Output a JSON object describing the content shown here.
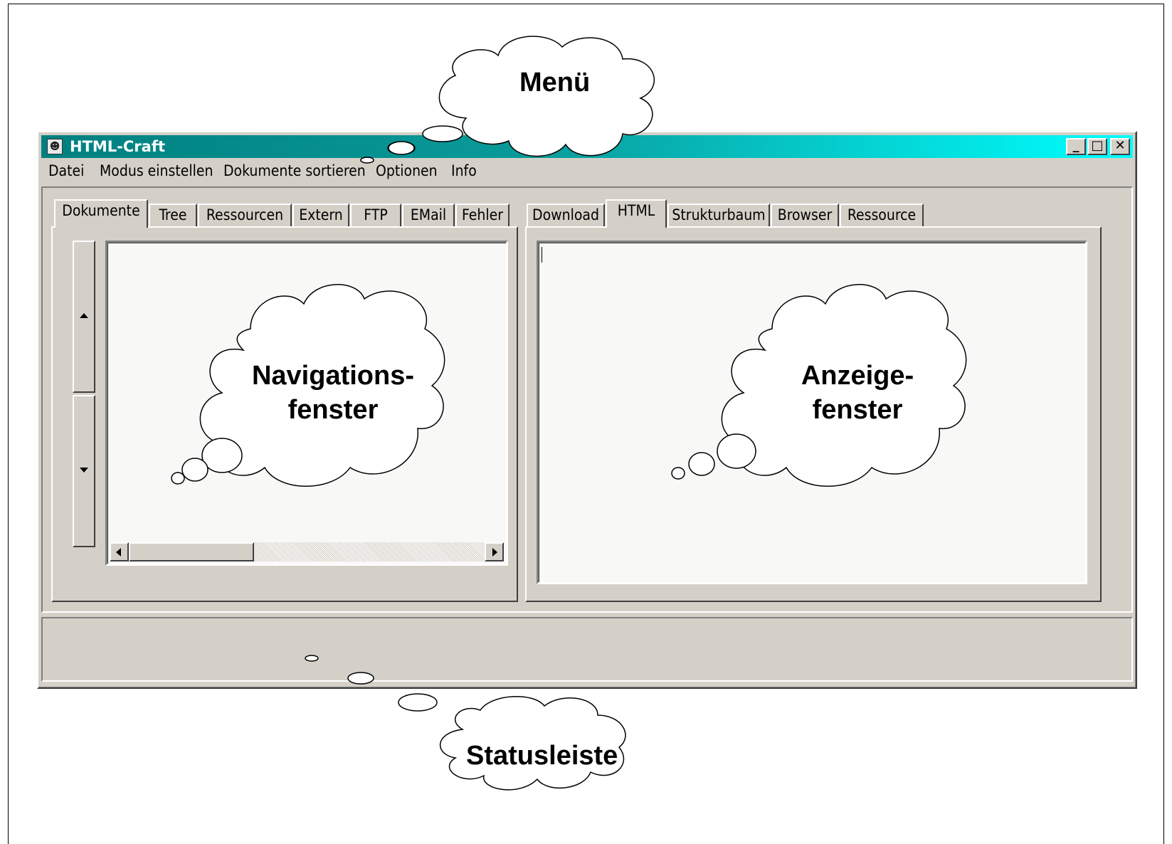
{
  "window": {
    "title": "HTML-Craft",
    "icon": "app-icon",
    "minimize_glyph": "_",
    "maximize_glyph": "□",
    "close_glyph": "✕"
  },
  "menu": {
    "items": [
      "Datei",
      "Modus einstellen",
      "Dokumente sortieren",
      "Optionen",
      "Info"
    ]
  },
  "left_panel": {
    "tabs": [
      "Dokumente",
      "Tree",
      "Ressourcen",
      "Extern",
      "FTP",
      "EMail",
      "Fehler"
    ],
    "active_tab": "Dokumente"
  },
  "right_panel": {
    "tabs": [
      "Download",
      "HTML",
      "Strukturbaum",
      "Browser",
      "Ressource"
    ],
    "active_tab": "HTML"
  },
  "callouts": {
    "menu": "Menü",
    "navigation": [
      "Navigations-",
      "fenster"
    ],
    "display": [
      "Anzeige-",
      "fenster"
    ],
    "status": "Statusleiste"
  },
  "colors": {
    "titlebar_start": "#008080",
    "titlebar_end": "#00ffff",
    "face": "#d4d0c8"
  }
}
